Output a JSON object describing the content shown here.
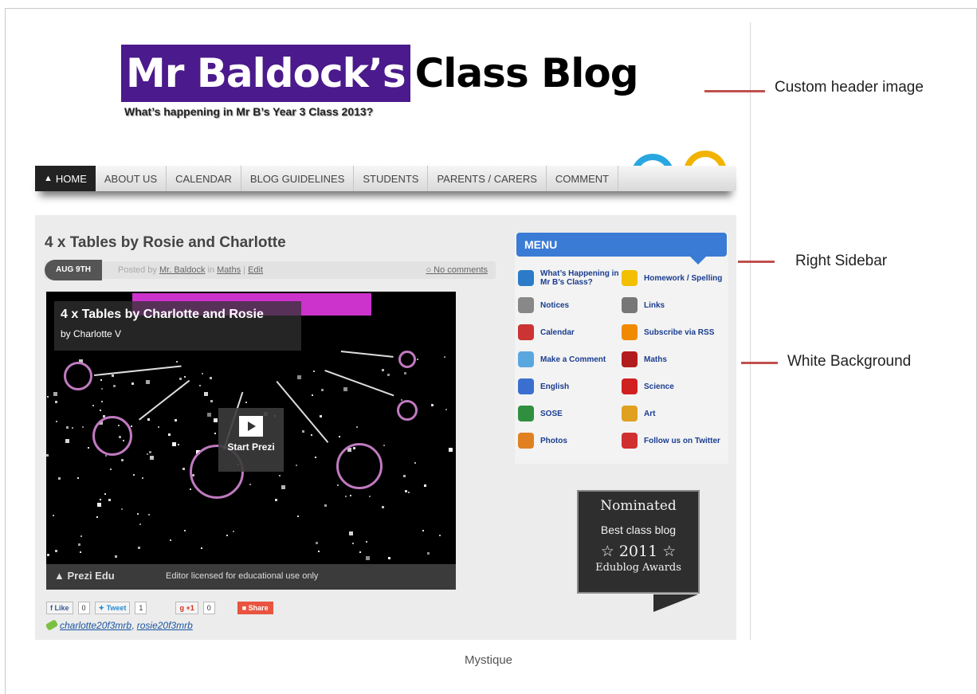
{
  "blog": {
    "title_highlight": "Mr Baldock’s",
    "title_rest": "Class Blog",
    "subtitle": "What’s happening in Mr B’s Year 3 Class 2013?"
  },
  "nav": {
    "items": [
      "HOME",
      "ABOUT US",
      "CALENDAR",
      "BLOG GUIDELINES",
      "STUDENTS",
      "PARENTS / CARERS",
      "COMMENT"
    ]
  },
  "post": {
    "title": "4 x Tables by Rosie and Charlotte",
    "date": "AUG 9TH",
    "posted_by_prefix": "Posted by",
    "author": "Mr. Baldock",
    "in_word": "in",
    "category": "Maths",
    "separator": "|",
    "edit": "Edit",
    "comments": "No comments"
  },
  "prezi": {
    "title": "4 x Tables by Charlotte and Rosie",
    "byline": "by Charlotte V",
    "start_label": "Start Prezi",
    "brand": "Prezi Edu",
    "license": "Editor licensed for educational use only"
  },
  "social": {
    "like_label": "Like",
    "like_count": "0",
    "tweet_label": "Tweet",
    "tweet_count": "1",
    "plus_label": "+1",
    "plus_count": "0",
    "share_label": "Share"
  },
  "tags": [
    "charlotte20f3mrb",
    "rosie20f3mrb"
  ],
  "tags_separator": ",",
  "sidebar": {
    "menu_title": "MENU",
    "items": [
      {
        "label": "What’s Happening in Mr B’s Class?",
        "icon": "info-icon",
        "color": "#2b7bc9"
      },
      {
        "label": "Homework / Spelling",
        "icon": "star-icon",
        "color": "#f2c000"
      },
      {
        "label": "Notices",
        "icon": "notice-icon",
        "color": "#888888"
      },
      {
        "label": "Links",
        "icon": "link-icon",
        "color": "#777777"
      },
      {
        "label": "Calendar",
        "icon": "calendar-icon",
        "color": "#cc3333"
      },
      {
        "label": "Subscribe via RSS",
        "icon": "rss-icon",
        "color": "#f08a00"
      },
      {
        "label": "Make a Comment",
        "icon": "comment-icon",
        "color": "#5aa7e0"
      },
      {
        "label": "Maths",
        "icon": "maths-icon",
        "color": "#b31c1c"
      },
      {
        "label": "English",
        "icon": "books-icon",
        "color": "#3a6fd0"
      },
      {
        "label": "Science",
        "icon": "magnet-icon",
        "color": "#d02020"
      },
      {
        "label": "SOSE",
        "icon": "globe-icon",
        "color": "#2f8f3f"
      },
      {
        "label": "Art",
        "icon": "art-icon",
        "color": "#e0a020"
      },
      {
        "label": "Photos",
        "icon": "camera-icon",
        "color": "#e08020"
      },
      {
        "label": "Follow us on Twitter",
        "icon": "twitter-icon",
        "color": "#d03030"
      }
    ]
  },
  "award": {
    "line1": "Nominated",
    "line2": "Best class blog",
    "year": "2011",
    "line4": "Edublog Awards"
  },
  "annotations": {
    "header": "Custom header image",
    "sidebar": "Right Sidebar",
    "background": "White Background"
  },
  "caption": "Mystique",
  "colors": {
    "annotation_line": "#c0504d",
    "title_purple": "#4b1a8c",
    "menu_blue": "#3a7bd5"
  }
}
